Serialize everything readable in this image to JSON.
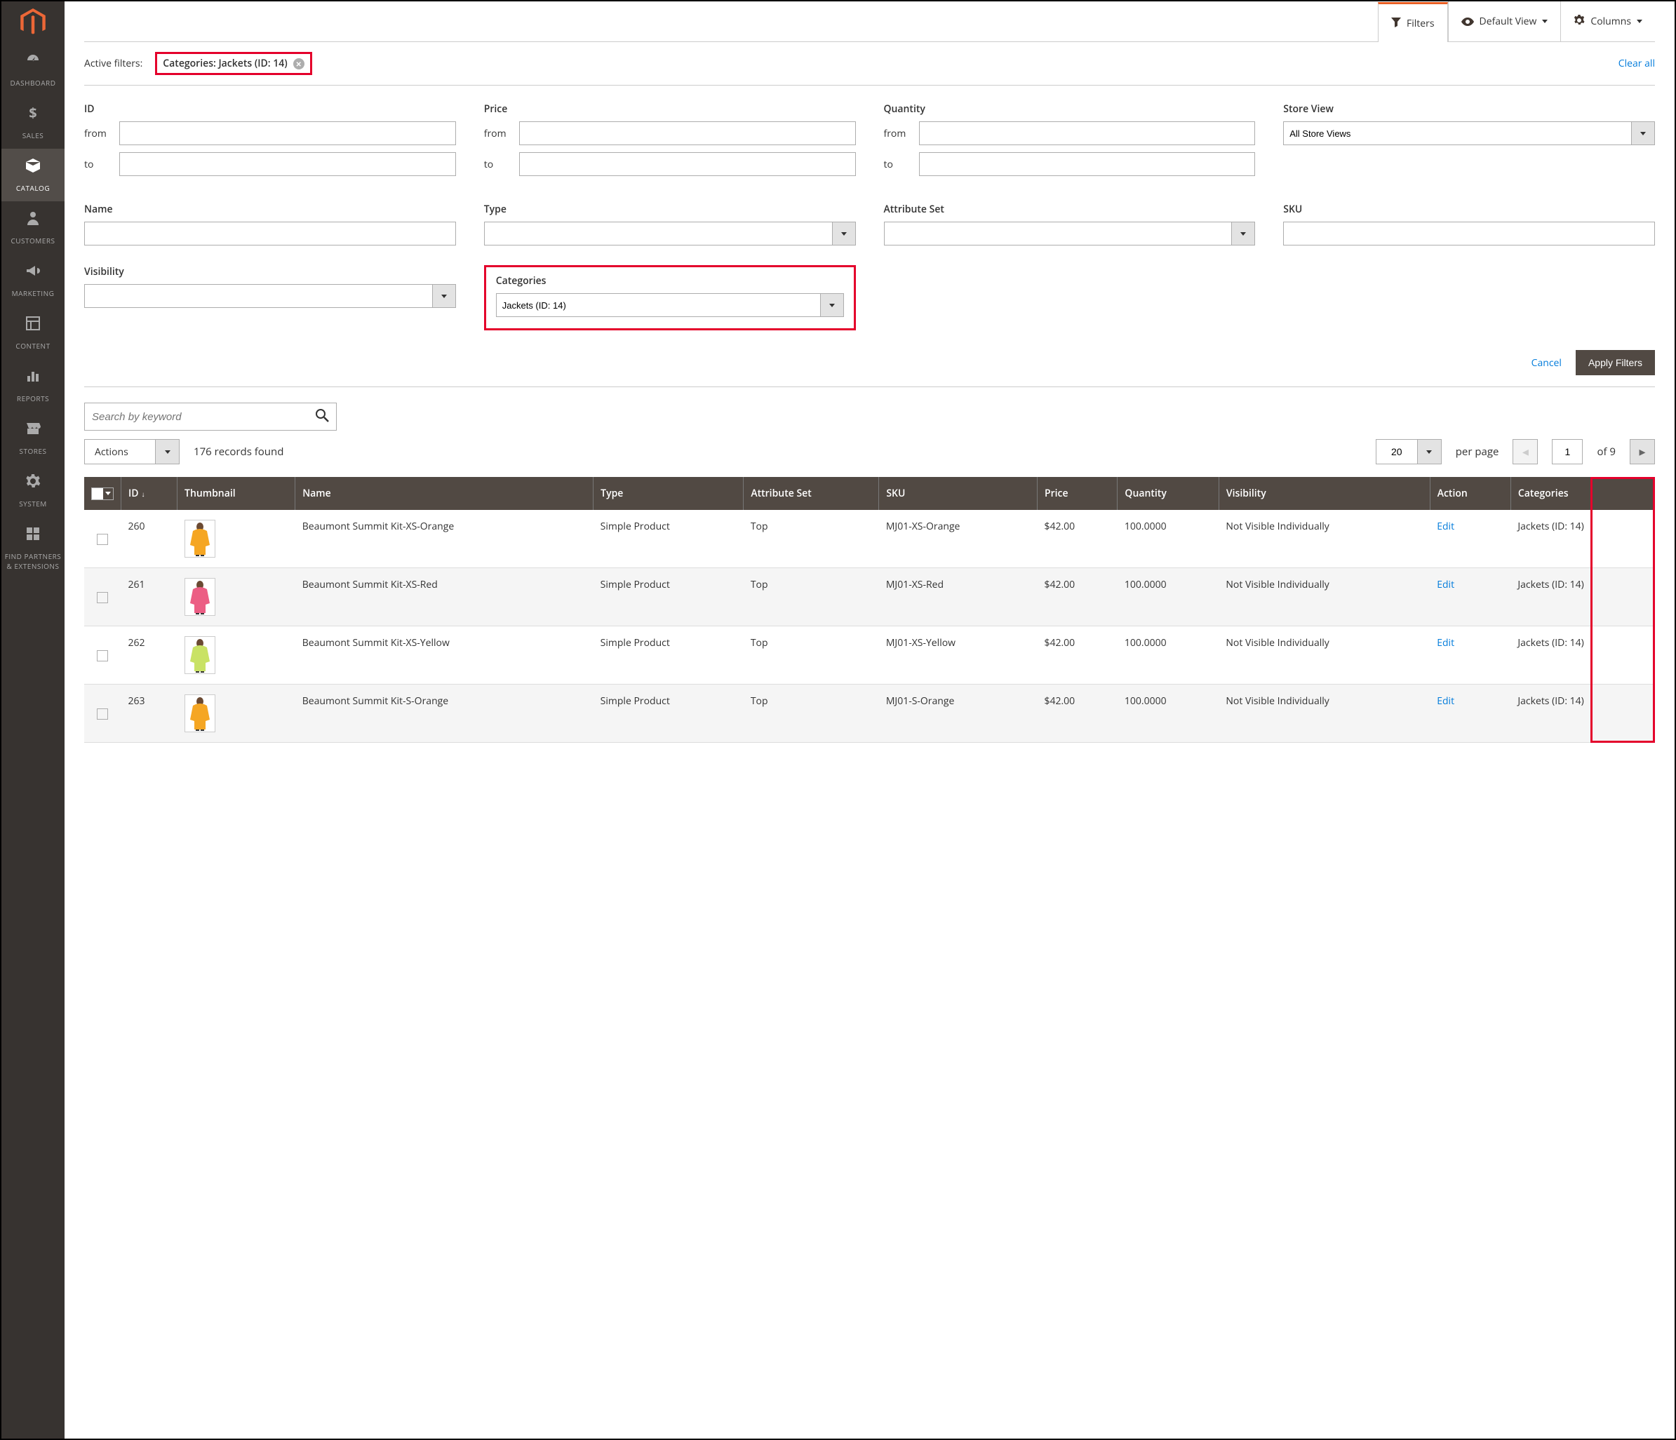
{
  "sidebar": {
    "items": [
      {
        "label": "DASHBOARD",
        "icon": "dashboard"
      },
      {
        "label": "SALES",
        "icon": "dollar"
      },
      {
        "label": "CATALOG",
        "icon": "box",
        "active": true
      },
      {
        "label": "CUSTOMERS",
        "icon": "person"
      },
      {
        "label": "MARKETING",
        "icon": "megaphone"
      },
      {
        "label": "CONTENT",
        "icon": "layout"
      },
      {
        "label": "REPORTS",
        "icon": "bars"
      },
      {
        "label": "STORES",
        "icon": "store"
      },
      {
        "label": "SYSTEM",
        "icon": "gear"
      },
      {
        "label": "FIND PARTNERS & EXTENSIONS",
        "icon": "blocks"
      }
    ]
  },
  "toolbar": {
    "filters": "Filters",
    "default_view": "Default View",
    "columns": "Columns"
  },
  "active_filters": {
    "label": "Active filters:",
    "chip": "Categories: Jackets (ID: 14)",
    "clear_all": "Clear all"
  },
  "filters": {
    "id_label": "ID",
    "price_label": "Price",
    "quantity_label": "Quantity",
    "store_view_label": "Store View",
    "store_view_value": "All Store Views",
    "from": "from",
    "to": "to",
    "name_label": "Name",
    "type_label": "Type",
    "attr_set_label": "Attribute Set",
    "sku_label": "SKU",
    "visibility_label": "Visibility",
    "categories_label": "Categories",
    "categories_value": "Jackets (ID: 14)",
    "cancel": "Cancel",
    "apply": "Apply Filters"
  },
  "search": {
    "placeholder": "Search by keyword"
  },
  "listing": {
    "actions_label": "Actions",
    "records_found": "176 records found",
    "per_page_value": "20",
    "per_page_label": "per page",
    "current_page": "1",
    "of_label": "of 9"
  },
  "table": {
    "headers": {
      "id": "ID",
      "thumbnail": "Thumbnail",
      "name": "Name",
      "type": "Type",
      "attr_set": "Attribute Set",
      "sku": "SKU",
      "price": "Price",
      "quantity": "Quantity",
      "visibility": "Visibility",
      "action": "Action",
      "categories": "Categories"
    },
    "rows": [
      {
        "id": "260",
        "name": "Beaumont Summit Kit-XS-Orange",
        "type": "Simple Product",
        "attr_set": "Top",
        "sku": "MJ01-XS-Orange",
        "price": "$42.00",
        "qty": "100.0000",
        "visibility": "Not Visible Individually",
        "action": "Edit",
        "categories": "Jackets (ID: 14)",
        "color": "#f5a623"
      },
      {
        "id": "261",
        "name": "Beaumont Summit Kit-XS-Red",
        "type": "Simple Product",
        "attr_set": "Top",
        "sku": "MJ01-XS-Red",
        "price": "$42.00",
        "qty": "100.0000",
        "visibility": "Not Visible Individually",
        "action": "Edit",
        "categories": "Jackets (ID: 14)",
        "color": "#ec5e84"
      },
      {
        "id": "262",
        "name": "Beaumont Summit Kit-XS-Yellow",
        "type": "Simple Product",
        "attr_set": "Top",
        "sku": "MJ01-XS-Yellow",
        "price": "$42.00",
        "qty": "100.0000",
        "visibility": "Not Visible Individually",
        "action": "Edit",
        "categories": "Jackets (ID: 14)",
        "color": "#c9e265"
      },
      {
        "id": "263",
        "name": "Beaumont Summit Kit-S-Orange",
        "type": "Simple Product",
        "attr_set": "Top",
        "sku": "MJ01-S-Orange",
        "price": "$42.00",
        "qty": "100.0000",
        "visibility": "Not Visible Individually",
        "action": "Edit",
        "categories": "Jackets (ID: 14)",
        "color": "#f5a623"
      }
    ]
  }
}
